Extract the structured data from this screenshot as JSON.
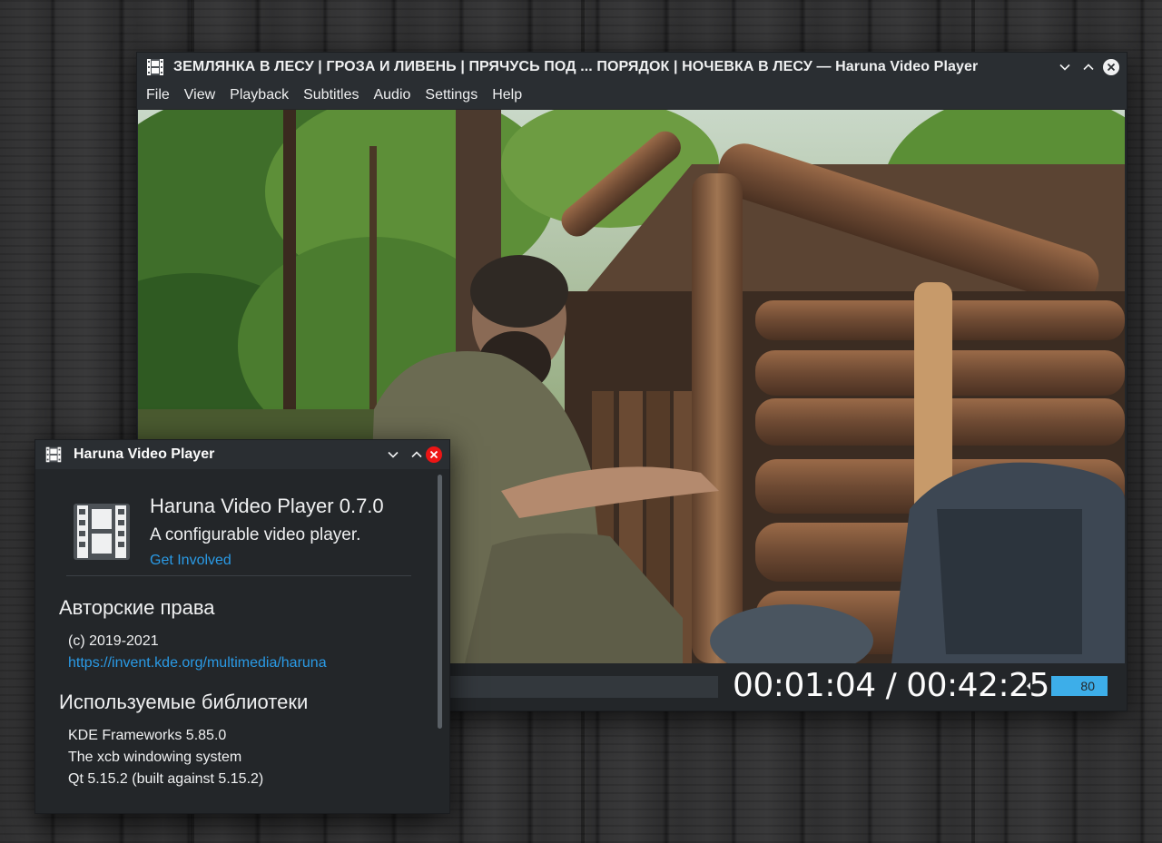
{
  "main_window": {
    "title": "ЗЕМЛЯНКА В ЛЕСУ | ГРОЗА И ЛИВЕНЬ | ПРЯЧУСЬ ПОД ... ПОРЯДОК | НОЧЕВКА В ЛЕСУ — Haruna Video Player",
    "menu": [
      "File",
      "View",
      "Playback",
      "Subtitles",
      "Audio",
      "Settings",
      "Help"
    ],
    "time_display": "00:01:04 / 00:42:25",
    "volume": "80"
  },
  "about_dialog": {
    "title": "Haruna Video Player",
    "app_name": "Haruna Video Player 0.7.0",
    "description": "A configurable video player.",
    "get_involved": "Get Involved",
    "copyright_heading": "Авторские права",
    "copyright_years": "(c) 2019-2021",
    "homepage": "https://invent.kde.org/multimedia/haruna",
    "libraries_heading": "Используемые библиотеки",
    "libraries": [
      "KDE Frameworks 5.85.0",
      "The xcb windowing system",
      "Qt 5.15.2 (built against 5.15.2)"
    ]
  },
  "icons": {
    "app": "film-strip-icon",
    "minimize": "chevron-down-icon",
    "maximize": "chevron-up-icon",
    "close": "close-icon",
    "volume": "speaker-icon"
  },
  "colors": {
    "accent": "#3daee9",
    "link": "#2a9ae5",
    "close_active": "#ed1515",
    "window_bg": "#232629"
  }
}
